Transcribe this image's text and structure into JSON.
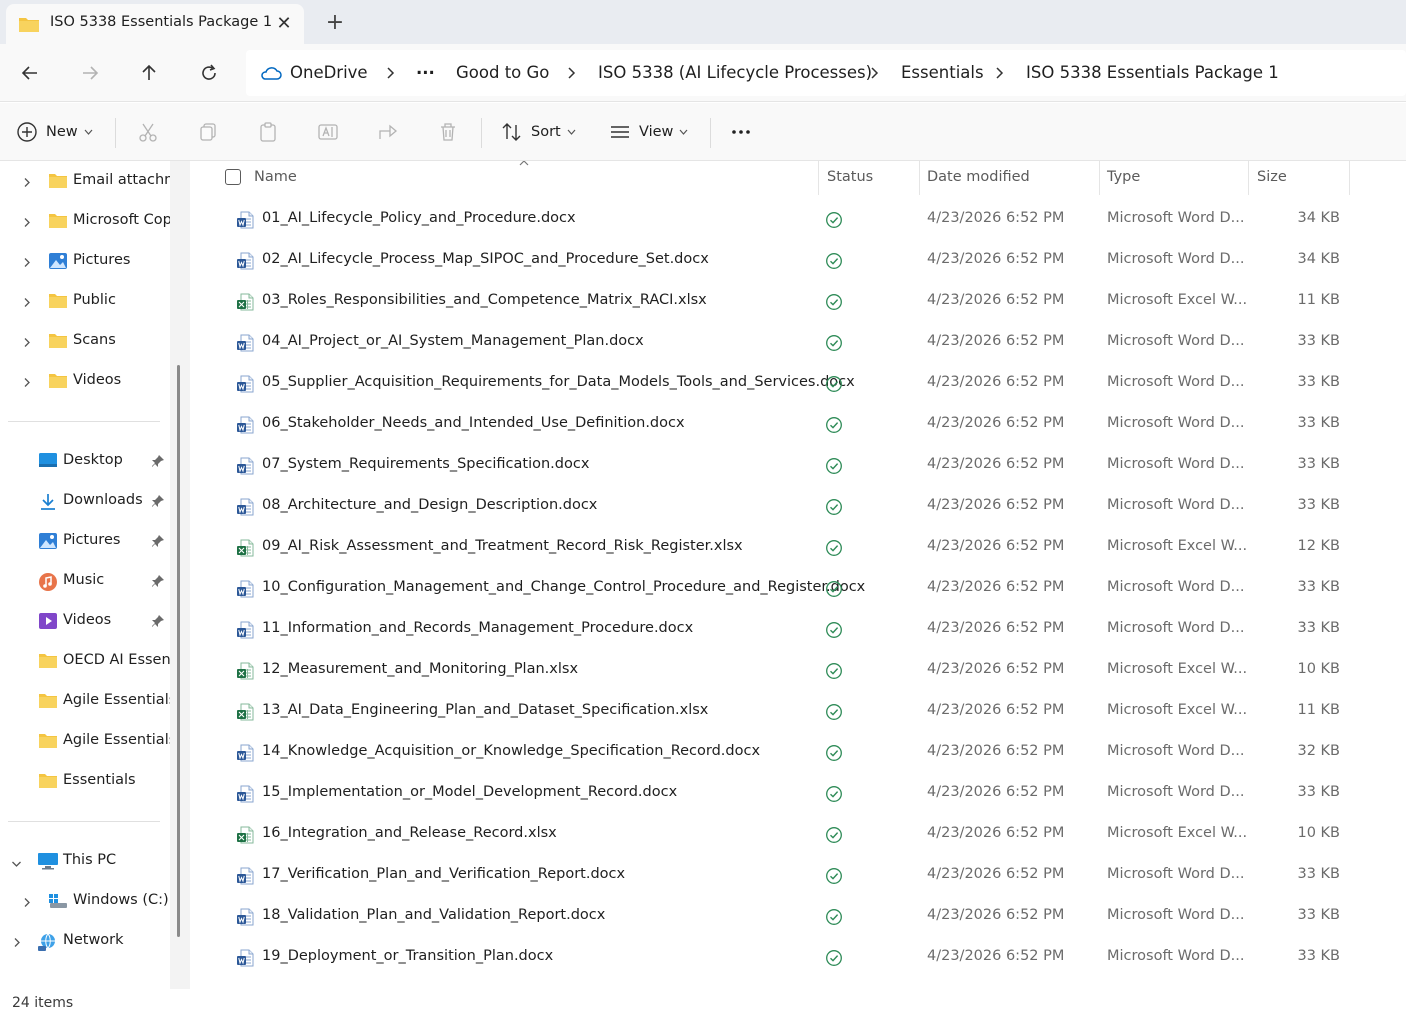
{
  "tab": {
    "title": "ISO 5338 Essentials Package 1"
  },
  "breadcrumb": [
    "OneDrive",
    "...",
    "Good to Go",
    "ISO 5338 (AI Lifecycle Processes)",
    "Essentials",
    "ISO 5338 Essentials Package 1"
  ],
  "toolbar": {
    "new_label": "New",
    "sort_label": "Sort",
    "view_label": "View"
  },
  "sidebar": {
    "tree_items": [
      {
        "label": "Email attachm",
        "icon": "folder-icon"
      },
      {
        "label": "Microsoft Copi",
        "icon": "folder-icon"
      },
      {
        "label": "Pictures",
        "icon": "pictures-icon"
      },
      {
        "label": "Public",
        "icon": "folder-icon"
      },
      {
        "label": "Scans",
        "icon": "folder-icon"
      },
      {
        "label": "Videos",
        "icon": "folder-icon"
      }
    ],
    "quick_access": [
      {
        "label": "Desktop",
        "icon": "desktop-icon",
        "pinned": true
      },
      {
        "label": "Downloads",
        "icon": "download-icon",
        "pinned": true
      },
      {
        "label": "Pictures",
        "icon": "pictures-icon",
        "pinned": true
      },
      {
        "label": "Music",
        "icon": "music-icon",
        "pinned": true
      },
      {
        "label": "Videos",
        "icon": "videos-icon",
        "pinned": true
      },
      {
        "label": "OECD AI Essenti",
        "icon": "folder-icon",
        "pinned": false
      },
      {
        "label": "Agile Essentials",
        "icon": "folder-icon",
        "pinned": false
      },
      {
        "label": "Agile Essentials",
        "icon": "folder-icon",
        "pinned": false
      },
      {
        "label": "Essentials",
        "icon": "folder-icon",
        "pinned": false
      }
    ],
    "this_pc": "This PC",
    "windows_drive": "Windows (C:)",
    "network": "Network"
  },
  "columns": {
    "name": "Name",
    "status": "Status",
    "date": "Date modified",
    "type": "Type",
    "size": "Size"
  },
  "files": [
    {
      "name": "01_AI_Lifecycle_Policy_and_Procedure.docx",
      "kind": "word",
      "date": "4/23/2026 6:52 PM",
      "type": "Microsoft Word D...",
      "size": "34 KB"
    },
    {
      "name": "02_AI_Lifecycle_Process_Map_SIPOC_and_Procedure_Set.docx",
      "kind": "word",
      "date": "4/23/2026 6:52 PM",
      "type": "Microsoft Word D...",
      "size": "34 KB"
    },
    {
      "name": "03_Roles_Responsibilities_and_Competence_Matrix_RACI.xlsx",
      "kind": "excel",
      "date": "4/23/2026 6:52 PM",
      "type": "Microsoft Excel W...",
      "size": "11 KB"
    },
    {
      "name": "04_AI_Project_or_AI_System_Management_Plan.docx",
      "kind": "word",
      "date": "4/23/2026 6:52 PM",
      "type": "Microsoft Word D...",
      "size": "33 KB"
    },
    {
      "name": "05_Supplier_Acquisition_Requirements_for_Data_Models_Tools_and_Services.docx",
      "kind": "word",
      "date": "4/23/2026 6:52 PM",
      "type": "Microsoft Word D...",
      "size": "33 KB"
    },
    {
      "name": "06_Stakeholder_Needs_and_Intended_Use_Definition.docx",
      "kind": "word",
      "date": "4/23/2026 6:52 PM",
      "type": "Microsoft Word D...",
      "size": "33 KB"
    },
    {
      "name": "07_System_Requirements_Specification.docx",
      "kind": "word",
      "date": "4/23/2026 6:52 PM",
      "type": "Microsoft Word D...",
      "size": "33 KB"
    },
    {
      "name": "08_Architecture_and_Design_Description.docx",
      "kind": "word",
      "date": "4/23/2026 6:52 PM",
      "type": "Microsoft Word D...",
      "size": "33 KB"
    },
    {
      "name": "09_AI_Risk_Assessment_and_Treatment_Record_Risk_Register.xlsx",
      "kind": "excel",
      "date": "4/23/2026 6:52 PM",
      "type": "Microsoft Excel W...",
      "size": "12 KB"
    },
    {
      "name": "10_Configuration_Management_and_Change_Control_Procedure_and_Register.docx",
      "kind": "word",
      "date": "4/23/2026 6:52 PM",
      "type": "Microsoft Word D...",
      "size": "33 KB"
    },
    {
      "name": "11_Information_and_Records_Management_Procedure.docx",
      "kind": "word",
      "date": "4/23/2026 6:52 PM",
      "type": "Microsoft Word D...",
      "size": "33 KB"
    },
    {
      "name": "12_Measurement_and_Monitoring_Plan.xlsx",
      "kind": "excel",
      "date": "4/23/2026 6:52 PM",
      "type": "Microsoft Excel W...",
      "size": "10 KB"
    },
    {
      "name": "13_AI_Data_Engineering_Plan_and_Dataset_Specification.xlsx",
      "kind": "excel",
      "date": "4/23/2026 6:52 PM",
      "type": "Microsoft Excel W...",
      "size": "11 KB"
    },
    {
      "name": "14_Knowledge_Acquisition_or_Knowledge_Specification_Record.docx",
      "kind": "word",
      "date": "4/23/2026 6:52 PM",
      "type": "Microsoft Word D...",
      "size": "32 KB"
    },
    {
      "name": "15_Implementation_or_Model_Development_Record.docx",
      "kind": "word",
      "date": "4/23/2026 6:52 PM",
      "type": "Microsoft Word D...",
      "size": "33 KB"
    },
    {
      "name": "16_Integration_and_Release_Record.xlsx",
      "kind": "excel",
      "date": "4/23/2026 6:52 PM",
      "type": "Microsoft Excel W...",
      "size": "10 KB"
    },
    {
      "name": "17_Verification_Plan_and_Verification_Report.docx",
      "kind": "word",
      "date": "4/23/2026 6:52 PM",
      "type": "Microsoft Word D...",
      "size": "33 KB"
    },
    {
      "name": "18_Validation_Plan_and_Validation_Report.docx",
      "kind": "word",
      "date": "4/23/2026 6:52 PM",
      "type": "Microsoft Word D...",
      "size": "33 KB"
    },
    {
      "name": "19_Deployment_or_Transition_Plan.docx",
      "kind": "word",
      "date": "4/23/2026 6:52 PM",
      "type": "Microsoft Word D...",
      "size": "33 KB"
    }
  ],
  "status_bar": {
    "item_count": "24 items"
  },
  "colors": {
    "word": "#2b5797",
    "excel": "#1e7145",
    "folder": "#f4c542",
    "status_ok": "#2e8b57",
    "accent": "#0067c0"
  }
}
